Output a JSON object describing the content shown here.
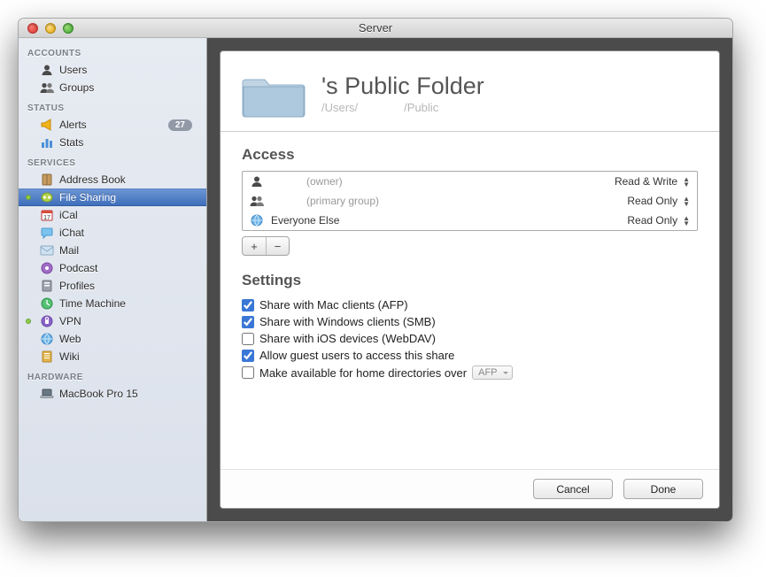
{
  "window": {
    "title": "Server"
  },
  "sidebar": {
    "sections": {
      "accounts": {
        "header": "ACCOUNTS",
        "items": [
          {
            "label": "Users",
            "icon": "user-icon"
          },
          {
            "label": "Groups",
            "icon": "group-icon"
          }
        ]
      },
      "status": {
        "header": "STATUS",
        "items": [
          {
            "label": "Alerts",
            "icon": "megaphone-icon",
            "badge": "27"
          },
          {
            "label": "Stats",
            "icon": "barchart-icon"
          }
        ]
      },
      "services": {
        "header": "SERVICES",
        "items": [
          {
            "label": "Address Book",
            "icon": "addressbook-icon"
          },
          {
            "label": "File Sharing",
            "icon": "filesharing-icon",
            "running": true,
            "selected": true
          },
          {
            "label": "iCal",
            "icon": "calendar-icon"
          },
          {
            "label": "iChat",
            "icon": "chat-icon"
          },
          {
            "label": "Mail",
            "icon": "mail-icon"
          },
          {
            "label": "Podcast",
            "icon": "podcast-icon"
          },
          {
            "label": "Profiles",
            "icon": "profiles-icon"
          },
          {
            "label": "Time Machine",
            "icon": "timemachine-icon"
          },
          {
            "label": "VPN",
            "icon": "vpn-icon",
            "running": true
          },
          {
            "label": "Web",
            "icon": "web-icon"
          },
          {
            "label": "Wiki",
            "icon": "wiki-icon"
          }
        ]
      },
      "hardware": {
        "header": "HARDWARE",
        "items": [
          {
            "label": "MacBook Pro 15",
            "icon": "laptop-icon"
          }
        ]
      }
    }
  },
  "detail": {
    "title": "'s Public Folder",
    "path_prefix": "/Users/",
    "path_suffix": "/Public",
    "access_header": "Access",
    "access": [
      {
        "name": "",
        "qualifier": "(owner)",
        "perm": "Read & Write",
        "icon": "user-icon"
      },
      {
        "name": "",
        "qualifier": "(primary group)",
        "perm": "Read Only",
        "icon": "group-icon"
      },
      {
        "name": "Everyone Else",
        "qualifier": "",
        "perm": "Read Only",
        "icon": "globe-icon"
      }
    ],
    "settings_header": "Settings",
    "settings": [
      {
        "label": "Share with Mac clients (AFP)",
        "checked": true
      },
      {
        "label": "Share with Windows clients (SMB)",
        "checked": true
      },
      {
        "label": "Share with iOS devices (WebDAV)",
        "checked": false
      },
      {
        "label": "Allow guest users to access this share",
        "checked": true
      },
      {
        "label": "Make available for home directories over",
        "checked": false,
        "select": "AFP"
      }
    ],
    "buttons": {
      "cancel": "Cancel",
      "done": "Done"
    }
  }
}
